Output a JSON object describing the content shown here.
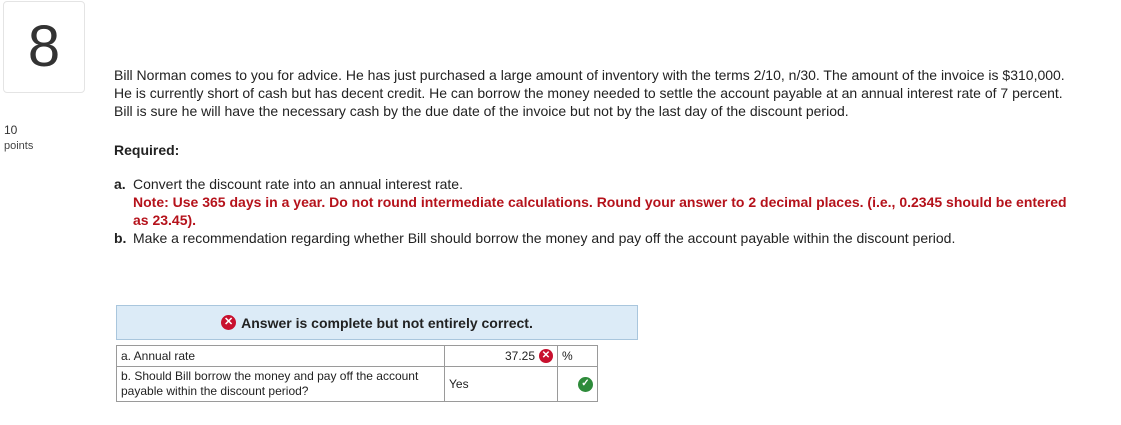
{
  "question": {
    "number": "8",
    "points_value": "10",
    "points_label": "points"
  },
  "prompt": {
    "paragraph": "Bill Norman comes to you for advice. He has just purchased a large amount of inventory with the terms 2/10, n/30. The amount of the invoice is $310,000. He is currently short of cash but has decent credit. He can borrow the money needed to settle the account payable at an annual interest rate of 7 percent. Bill is sure he will have the necessary cash by the due date of the invoice but not by the last day of the discount period.",
    "required_heading": "Required:",
    "items": [
      {
        "letter": "a.",
        "text": "Convert the discount rate into an annual interest rate.",
        "note": "Note: Use 365 days in a year. Do not round intermediate calculations. Round your answer to 2 decimal places. (i.e., 0.2345 should be entered as 23.45)."
      },
      {
        "letter": "b.",
        "text": "Make a recommendation regarding whether Bill should borrow the money and pay off the account payable within the discount period."
      }
    ]
  },
  "result": {
    "banner_text": "Answer is complete but not entirely correct.",
    "banner_icon": "x-circle-icon",
    "colors": {
      "incorrect": "#c8102e",
      "correct": "#2e8b3a",
      "note": "#b5121b",
      "banner_bg": "#dcebf7"
    }
  },
  "answer_table": {
    "rows": [
      {
        "label": "a. Annual rate",
        "value": "37.25",
        "unit": "%",
        "status": "incorrect"
      },
      {
        "label": "b. Should Bill borrow the money and pay off the account payable within the discount period?",
        "value": "Yes",
        "unit": "",
        "status": "correct"
      }
    ]
  }
}
